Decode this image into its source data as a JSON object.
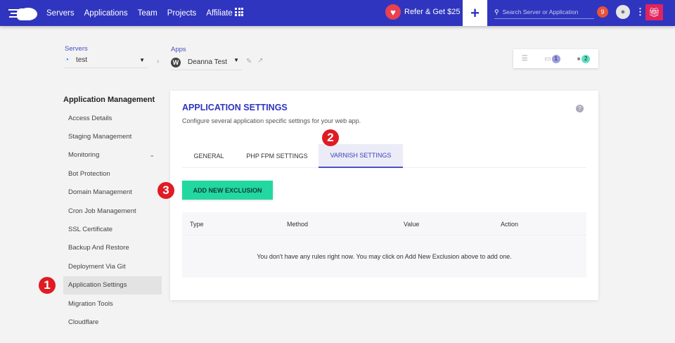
{
  "nav": {
    "items": [
      "Servers",
      "Applications",
      "Team",
      "Projects",
      "Affiliate"
    ],
    "refer": "Refer & Get $25",
    "search_placeholder": "Search Server or Application",
    "notifications": "9"
  },
  "breadcrumb": {
    "servers_label": "Servers",
    "server": "test",
    "apps_label": "Apps",
    "app": "Deanna Test"
  },
  "toolbox": {
    "folder_count": "1",
    "users_count": "2"
  },
  "sidebar": {
    "title": "Application Management",
    "items": [
      "Access Details",
      "Staging Management",
      "Monitoring",
      "Bot Protection",
      "Domain Management",
      "Cron Job Management",
      "SSL Certificate",
      "Backup And Restore",
      "Deployment Via Git",
      "Application Settings",
      "Migration Tools",
      "Cloudflare"
    ],
    "active": "Application Settings"
  },
  "main": {
    "title": "APPLICATION SETTINGS",
    "subtitle": "Configure several application specific settings for your web app.",
    "tabs": [
      "GENERAL",
      "PHP FPM SETTINGS",
      "VARNISH SETTINGS"
    ],
    "active_tab": "VARNISH SETTINGS",
    "add_button": "ADD NEW EXCLUSION",
    "table": {
      "columns": [
        "Type",
        "Method",
        "Value",
        "Action"
      ],
      "empty": "You don't have any rules right now. You may click on Add New Exclusion above to add one."
    }
  },
  "steps": [
    "1",
    "2",
    "3"
  ],
  "colors": {
    "brand": "#2f35be",
    "accent": "#22d8a0",
    "step": "#e01b22"
  }
}
